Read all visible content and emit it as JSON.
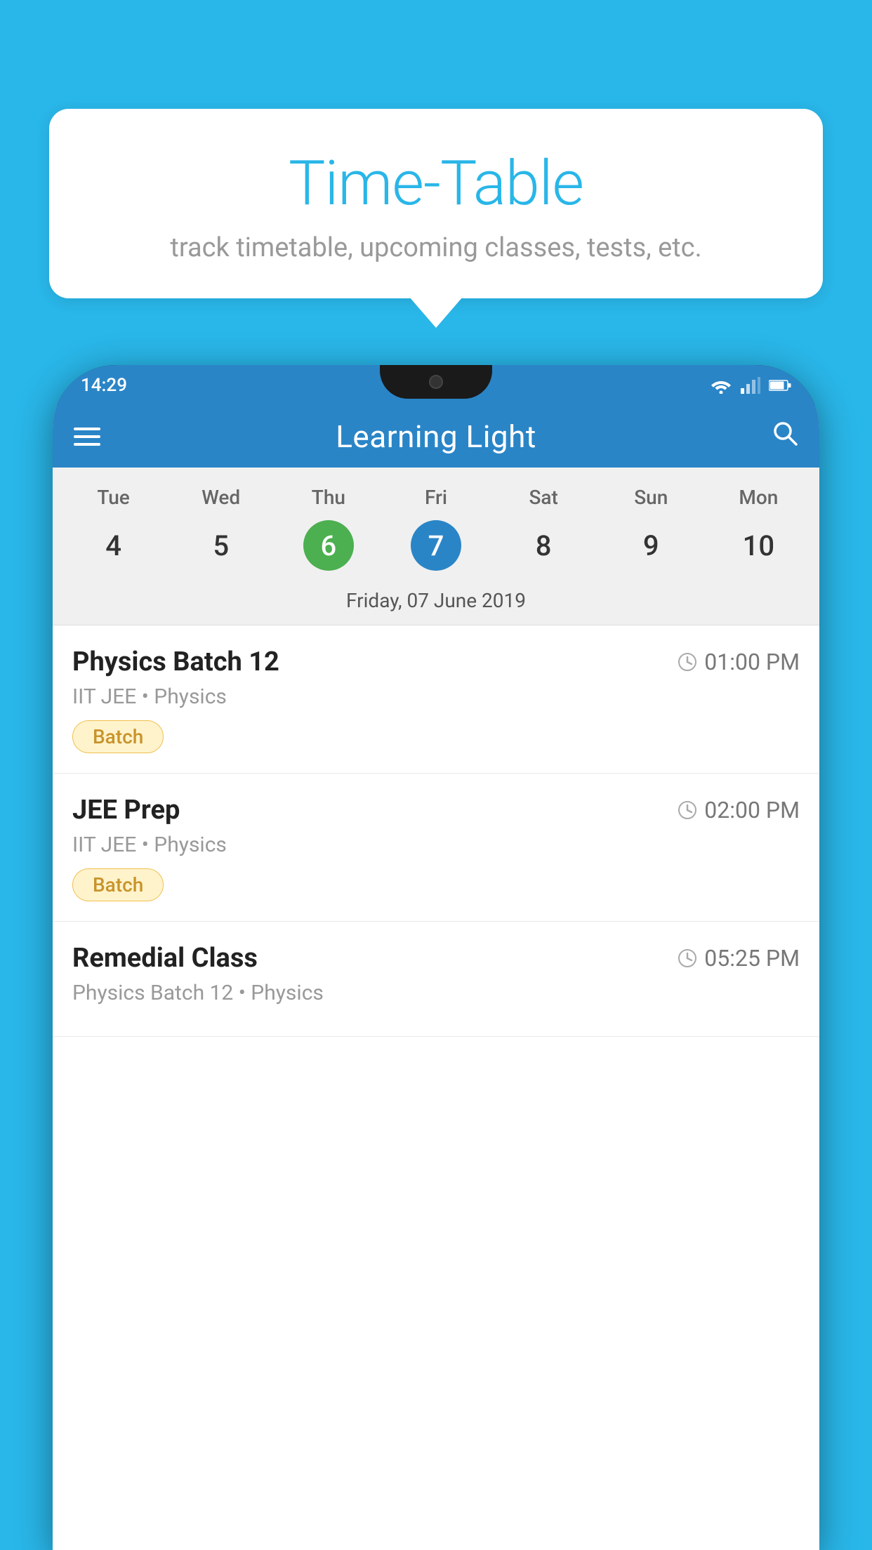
{
  "background_color": "#29b6e8",
  "speech_bubble": {
    "title": "Time-Table",
    "subtitle": "track timetable, upcoming classes, tests, etc."
  },
  "phone": {
    "status_bar": {
      "time": "14:29"
    },
    "app_header": {
      "title": "Learning Light"
    },
    "calendar": {
      "day_headers": [
        "Tue",
        "Wed",
        "Thu",
        "Fri",
        "Sat",
        "Sun",
        "Mon"
      ],
      "day_numbers": [
        "4",
        "5",
        "6",
        "7",
        "8",
        "9",
        "10"
      ],
      "today_green_index": 2,
      "today_blue_index": 3,
      "selected_date": "Friday, 07 June 2019"
    },
    "classes": [
      {
        "name": "Physics Batch 12",
        "time": "01:00 PM",
        "meta": "IIT JEE • Physics",
        "badge": "Batch"
      },
      {
        "name": "JEE Prep",
        "time": "02:00 PM",
        "meta": "IIT JEE • Physics",
        "badge": "Batch"
      },
      {
        "name": "Remedial Class",
        "time": "05:25 PM",
        "meta": "Physics Batch 12 • Physics",
        "badge": ""
      }
    ]
  }
}
